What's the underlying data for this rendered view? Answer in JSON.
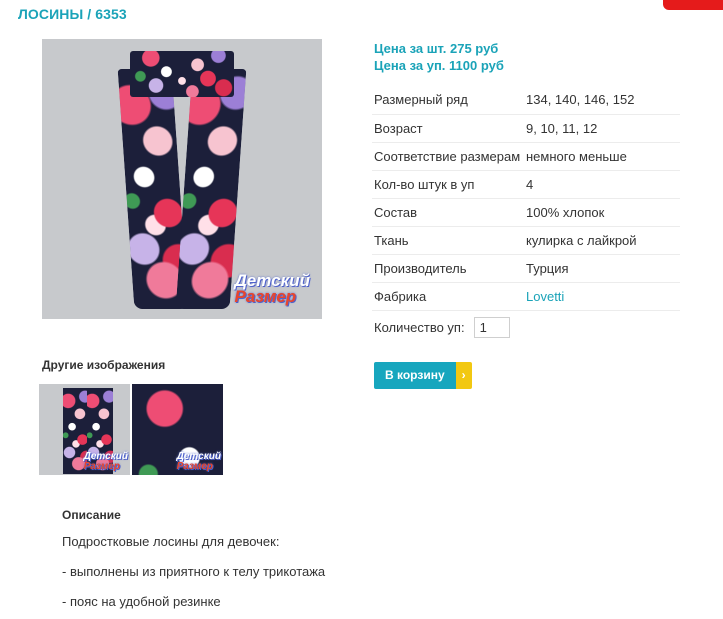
{
  "product": {
    "title": "ЛОСИНЫ / 6353"
  },
  "gallery": {
    "watermark_line1": "Детский",
    "watermark_line2": "Размер",
    "other_images_title": "Другие изображения"
  },
  "prices": {
    "per_piece": "Цена за шт. 275 руб",
    "per_pack": "Цена за уп. 1100 руб"
  },
  "specs": [
    {
      "label": "Размерный ряд",
      "value": "134, 140, 146, 152"
    },
    {
      "label": "Возраст",
      "value": "9, 10, 11, 12"
    },
    {
      "label": "Соответствие размерам",
      "value": "немного меньше"
    },
    {
      "label": "Кол-во штук в уп",
      "value": "4"
    },
    {
      "label": "Состав",
      "value": "100% хлопок"
    },
    {
      "label": "Ткань",
      "value": "кулирка с лайкрой"
    },
    {
      "label": "Производитель",
      "value": "Турция"
    },
    {
      "label": "Фабрика",
      "value": "Lovetti"
    }
  ],
  "order": {
    "quantity_label": "Количество уп:",
    "quantity_value": "1",
    "cart_button": "В корзину",
    "cart_arrow": "›"
  },
  "description": {
    "title": "Описание",
    "lines": [
      "Подростковые лосины для девочек:",
      "- выполнены из приятного к телу трикотажа",
      "- пояс на удобной резинке"
    ]
  },
  "colors": {
    "accent": "#1aa3b8",
    "cart_button": "#17a6be",
    "cart_arrow": "#f2c811",
    "corner_tab": "#e51b1b"
  }
}
